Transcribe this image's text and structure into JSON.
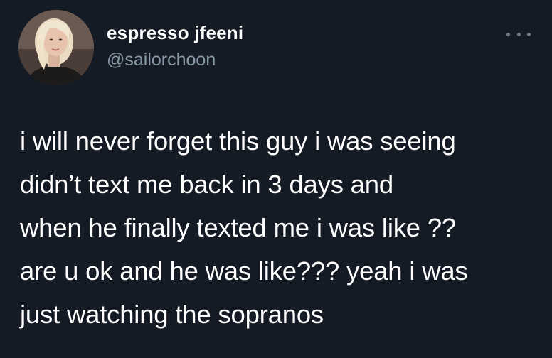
{
  "author": {
    "display_name": "espresso jfeeni",
    "handle": "@sailorchoon",
    "avatar_icon": "profile-photo"
  },
  "tweet": {
    "text": "i will never forget this guy i was seeing\ndidn’t text me back in 3 days and\nwhen he finally texted me i was like ??\nare u ok and he was like??? yeah i was\njust watching the sopranos"
  },
  "menu": {
    "more_icon": "more-horizontal-icon"
  },
  "colors": {
    "background": "#141b24",
    "text": "#ffffff",
    "handle": "#8899a6"
  }
}
